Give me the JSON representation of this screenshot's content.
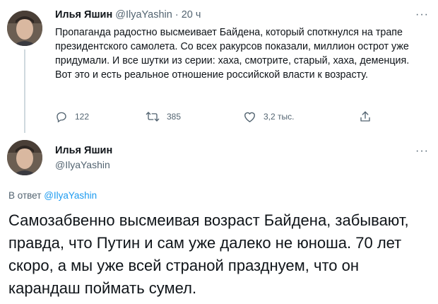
{
  "tweet1": {
    "author_name": "Илья Яшин",
    "handle": "@IlyaYashin",
    "separator": "·",
    "time": "20 ч",
    "more": "···",
    "text": "Пропаганда радостно высмеивает Байдена, который споткнулся на трапе президентского самолета. Со всех ракурсов показали, миллион острот уже придумали. И все шутки из серии: хаха, смотрите, старый, хаха, деменция. Вот это и есть реальное отношение российской власти к возрасту.",
    "replies": "122",
    "retweets": "385",
    "likes": "3,2 тыс."
  },
  "tweet2": {
    "author_name": "Илья Яшин",
    "handle": "@IlyaYashin",
    "more": "···",
    "reply_prefix": "В ответ",
    "reply_mention": "@IlyaYashin",
    "text": "Самозабвенно высмеивая возраст Байдена, забывают, правда, что Путин и сам уже далеко не юноша. 70 лет скоро, а мы уже всей страной празднуем, что он карандаш поймать сумел."
  },
  "icons": {
    "reply": "reply-icon",
    "retweet": "retweet-icon",
    "like": "heart-icon",
    "share": "share-icon"
  },
  "colors": {
    "text": "#0f1419",
    "secondary": "#536471",
    "link": "#1d9bf0",
    "thread_line": "#cfd9de"
  }
}
